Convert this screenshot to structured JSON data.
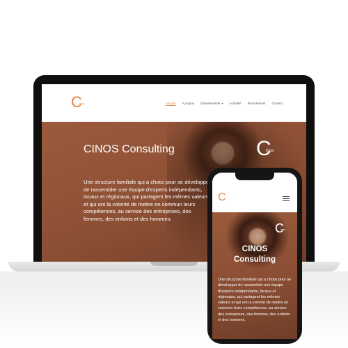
{
  "brand": {
    "logo_letter": "C",
    "logo_small": "inos"
  },
  "nav": {
    "items": [
      "Accueil",
      "A propos",
      "Départements",
      "Actualité",
      "Recrutement",
      "Contact"
    ],
    "active": "Accueil",
    "dropdown_icon": "chevron-down-icon"
  },
  "hero": {
    "title": "CINOS Consulting",
    "description": "Une structure familiale qui a choisi pour se développer de rassembler une équipe d'experts indépendants, locaux et régionaux, qui partagent les mêmes valeurs et qui ont la volonté de mettre en commun leurs compétences, au service des entreprises, des femmes, des enfants et des hommes."
  },
  "mobile": {
    "title_line1": "CINOS",
    "title_line2": "Consulting",
    "menu_icon": "hamburger-icon"
  },
  "colors": {
    "accent": "#e8823f",
    "hero_brown": "#8c4f34",
    "device": "#0f0f0f"
  }
}
